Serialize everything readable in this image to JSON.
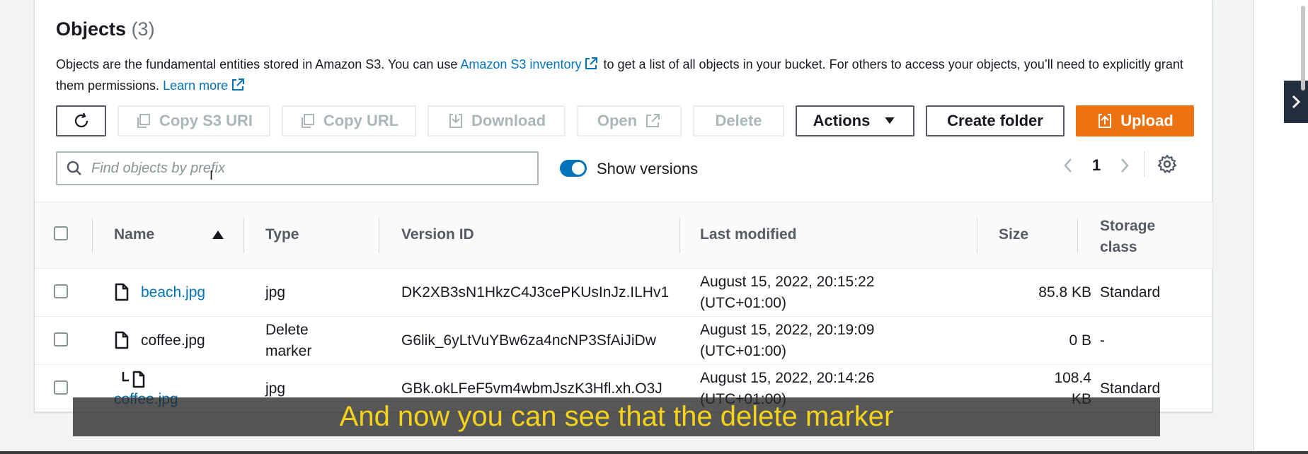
{
  "objects": {
    "title": "Objects",
    "count": "(3)",
    "description_prefix": "Objects are the fundamental entities stored in Amazon S3. You can use ",
    "inventory_link": "Amazon S3 inventory",
    "description_middle": " to get a list of all objects in your bucket. For others to access your objects, you’ll need to explicitly grant them permissions. ",
    "learn_more_link": "Learn more"
  },
  "toolbar": {
    "copy_s3_uri": "Copy S3 URI",
    "copy_url": "Copy URL",
    "download": "Download",
    "open": "Open",
    "delete": "Delete",
    "actions": "Actions",
    "create_folder": "Create folder",
    "upload": "Upload"
  },
  "search": {
    "placeholder": "Find objects by prefix",
    "value": ""
  },
  "versions_toggle": {
    "label": "Show versions",
    "enabled": true
  },
  "pagination": {
    "current_page": "1"
  },
  "table": {
    "columns": {
      "name": "Name",
      "type": "Type",
      "version_id": "Version ID",
      "last_modified": "Last modified",
      "size": "Size",
      "storage_class": "Storage class"
    },
    "rows": [
      {
        "name": "beach.jpg",
        "type": "jpg",
        "version_id": "DK2XB3sN1HkzC4J3cePKUsInJz.ILHv1",
        "last_modified_date": "August 15, 2022, 20:15:22",
        "last_modified_tz": "(UTC+01:00)",
        "size": "85.8 KB",
        "storage_class": "Standard"
      },
      {
        "name": "coffee.jpg",
        "type_line1": "Delete",
        "type_line2": "marker",
        "version_id": "G6lik_6yLtVuYBw6za4ncNP3SfAiJiDw",
        "last_modified_date": "August 15, 2022, 20:19:09",
        "last_modified_tz": "(UTC+01:00)",
        "size": "0 B",
        "storage_class": "-"
      },
      {
        "name": "coffee.jpg",
        "type": "jpg",
        "version_id": "GBk.okLFeF5vm4wbmJszK3Hfl.xh.O3J",
        "last_modified_date": "August 15, 2022, 20:14:26",
        "last_modified_tz": "(UTC+01:00)",
        "size_line1": "108.4",
        "size_line2": "KB",
        "storage_class": "Standard"
      }
    ]
  },
  "subtitle": "And now you can see that the delete marker",
  "colors": {
    "link": "#0073bb",
    "primary": "#ec7211",
    "toggle": "#0073bb",
    "subtitle_text": "#f7d21c"
  }
}
